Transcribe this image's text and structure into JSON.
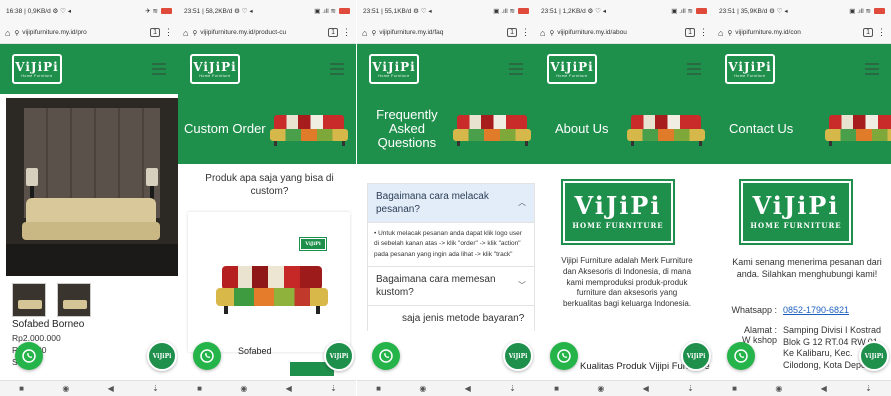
{
  "panels": [
    {
      "status": {
        "left": "16:38 | 0,9KB/d ⚙ ♡ ◂",
        "right": "✈ ≋"
      },
      "url": "vijipifurniture.my.id/pro",
      "product": {
        "name": "Sofabed Borneo",
        "price_line1": "Rp2.000.000",
        "price_line2": "R   75.000",
        "price_line3": "S    .7"
      }
    },
    {
      "status": {
        "left": "23:51 | 58,2KB/d ⚙ ♡ ◂",
        "right": "▣ .ıll ≋"
      },
      "url": "vijipifurniture.my.id/product-cu",
      "hero_title": "Custom Order",
      "question": "Produk apa saja yang bisa di custom?",
      "card_label": "Sofabed"
    },
    {
      "status": {
        "left": "23:51 | 55,1KB/d ⚙ ♡ ◂",
        "right": "▣ .ıll ≋"
      },
      "url": "vijipifurniture.my.id/faq",
      "hero_title": "Frequently Asked Questions",
      "faq": [
        {
          "q": "Bagaimana cara melacak pesanan?",
          "open": true
        },
        {
          "q": "Bagaimana cara memesan kustom?"
        },
        {
          "q": "saja jenis metode bayaran?"
        }
      ],
      "faq_answer": "Untuk melacak pesanan anda dapat klik logo user di sebelah kanan atas -> klik \"order\" -> klik \"action\" pada pesanan yang ingin ada lihat -> klik \"track\""
    },
    {
      "status": {
        "left": "23:51 | 1,2KB/d ⚙ ♡ ◂",
        "right": "▣ .ıll ≋"
      },
      "url": "vijipifurniture.my.id/abou",
      "hero_title": "About Us",
      "about_text": "Vijipi Furniture adalah Merk Furniture dan Aksesoris di Indonesia, di mana kami memproduksi produk-produk furniture dan aksesoris yang berkualitas bagi keluarga Indonesia.",
      "about_sub": "Kualitas Produk Vijipi Furniture"
    },
    {
      "status": {
        "left": "23:51 | 35,9KB/d ⚙ ♡ ◂",
        "right": "▣ .ıll ≋"
      },
      "url": "vijipifurniture.my.id/con",
      "hero_title": "Contact Us",
      "intro": "Kami senang menerima pesanan dari anda. Silahkan menghubungi kami!",
      "whatsapp_label": "Whatsapp :",
      "whatsapp_value": "0852-1790-6821",
      "address_label": "Alamat :",
      "address_label2": "W  kshop",
      "address_value": "Samping Divisi I Kostrad Blok G 12 RT.04 RW.01 Ke Kalibaru, Kec. Cilodong, Kota Depok"
    }
  ],
  "logo": {
    "name": "ViJiPi",
    "tagline": "HOME FURNITURE",
    "tagline_small": "Home Furniture"
  },
  "nav": {
    "square": "■",
    "circle": "◉",
    "back": "◀",
    "down": "⇣"
  },
  "colors": {
    "brand_green": "#1f8f4c",
    "whatsapp_green": "#25b44a",
    "faq_open": "#e3edf9"
  }
}
